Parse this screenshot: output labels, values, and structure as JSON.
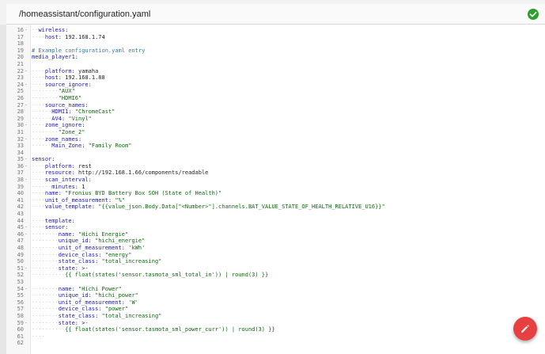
{
  "header": {
    "file_path": "/homeassistant/configuration.yaml",
    "status_icon": "check-circle-icon",
    "status_color": "#2aa22a"
  },
  "fab": {
    "icon": "pencil-icon",
    "color": "#e84040"
  },
  "editor": {
    "lines": [
      {
        "n": "16",
        "fold": "-",
        "ind": "··",
        "key": "wireless:",
        "val": "",
        "type": "key"
      },
      {
        "n": "17",
        "fold": "",
        "ind": "····",
        "key": "host:",
        "val": " 192.168.1.74",
        "type": "key"
      },
      {
        "n": "18",
        "fold": "",
        "ind": "",
        "key": "",
        "val": "",
        "type": "empty"
      },
      {
        "n": "19",
        "fold": "",
        "ind": "",
        "key": "",
        "val": "# Example configuration.yaml entry",
        "type": "comment"
      },
      {
        "n": "20",
        "fold": "",
        "ind": "",
        "key": "media_player1:",
        "val": "",
        "type": "key"
      },
      {
        "n": "21",
        "fold": "",
        "ind": "",
        "key": "",
        "val": "",
        "type": "empty"
      },
      {
        "n": "22",
        "fold": "-",
        "ind": "··-·",
        "key": "platform:",
        "val": " yamaha",
        "type": "key"
      },
      {
        "n": "23",
        "fold": "",
        "ind": "····",
        "key": "host:",
        "val": " 192.168.1.88",
        "type": "key"
      },
      {
        "n": "24",
        "fold": "-",
        "ind": "····",
        "key": "source_ignore:",
        "val": "",
        "type": "key"
      },
      {
        "n": "25",
        "fold": "",
        "ind": "······-·",
        "key": "",
        "val": "\"AUX\"",
        "type": "str"
      },
      {
        "n": "26",
        "fold": "",
        "ind": "······-·",
        "key": "",
        "val": "\"HDMI6\"",
        "type": "str"
      },
      {
        "n": "27",
        "fold": "-",
        "ind": "····",
        "key": "source_names:",
        "val": "",
        "type": "key"
      },
      {
        "n": "28",
        "fold": "",
        "ind": "······",
        "key": "HDMI1:",
        "val": " \"ChromeCast\"",
        "type": "keystr"
      },
      {
        "n": "29",
        "fold": "",
        "ind": "······",
        "key": "AV4:",
        "val": " \"Vinyl\"",
        "type": "keystr"
      },
      {
        "n": "30",
        "fold": "-",
        "ind": "····",
        "key": "zone_ignore:",
        "val": "",
        "type": "key"
      },
      {
        "n": "31",
        "fold": "",
        "ind": "······-·",
        "key": "",
        "val": "\"Zone_2\"",
        "type": "str"
      },
      {
        "n": "32",
        "fold": "-",
        "ind": "····",
        "key": "zone_names:",
        "val": "",
        "type": "key"
      },
      {
        "n": "33",
        "fold": "",
        "ind": "······",
        "key": "Main_Zone:",
        "val": " \"Family Room\"",
        "type": "keystr"
      },
      {
        "n": "34",
        "fold": "",
        "ind": "",
        "key": "",
        "val": "",
        "type": "empty"
      },
      {
        "n": "35",
        "fold": "-",
        "ind": "",
        "key": "sensor:",
        "val": "",
        "type": "key"
      },
      {
        "n": "36",
        "fold": "-",
        "ind": "··-·",
        "key": "platform:",
        "val": " rest",
        "type": "key"
      },
      {
        "n": "37",
        "fold": "",
        "ind": "····",
        "key": "resource:",
        "val": " http://192.168.1.66/components/readable",
        "type": "key"
      },
      {
        "n": "38",
        "fold": "-",
        "ind": "····",
        "key": "scan_interval:",
        "val": "",
        "type": "key"
      },
      {
        "n": "39",
        "fold": "",
        "ind": "······",
        "key": "minutes:",
        "val": " 1",
        "type": "key"
      },
      {
        "n": "40",
        "fold": "",
        "ind": "····",
        "key": "name:",
        "val": " \"Fronius BYD Battery Box SOH (State of Health)\"",
        "type": "keystr"
      },
      {
        "n": "41",
        "fold": "",
        "ind": "····",
        "key": "unit_of_measurement:",
        "val": " \"%\"",
        "type": "keystr"
      },
      {
        "n": "42",
        "fold": "",
        "ind": "····",
        "key": "value_template:",
        "val": " \"{{value_json.Body.Data[\"<Number>\"].channels.BAT_VALUE_STATE_OF_HEALTH_RELATIVE_U16}}\"",
        "type": "keystr"
      },
      {
        "n": "43",
        "fold": "",
        "ind": "",
        "key": "",
        "val": "",
        "type": "empty"
      },
      {
        "n": "44",
        "fold": "",
        "ind": "····",
        "key": "template:",
        "val": "",
        "type": "key"
      },
      {
        "n": "45",
        "fold": "-",
        "ind": "····",
        "key": "sensor:",
        "val": "",
        "type": "key"
      },
      {
        "n": "46",
        "fold": "-",
        "ind": "······-·",
        "key": "name:",
        "val": " \"Hichi Energie\"",
        "type": "keystr"
      },
      {
        "n": "47",
        "fold": "",
        "ind": "········",
        "key": "unique_id:",
        "val": " \"hichi_energie\"",
        "type": "keystr"
      },
      {
        "n": "48",
        "fold": "",
        "ind": "········",
        "key": "unit_of_measurement:",
        "val": " 'kWh'",
        "type": "keystr"
      },
      {
        "n": "49",
        "fold": "",
        "ind": "········",
        "key": "device_class:",
        "val": " \"energy\"",
        "type": "keystr"
      },
      {
        "n": "50",
        "fold": "",
        "ind": "········",
        "key": "state_class:",
        "val": " \"total_increasing\"",
        "type": "keystr"
      },
      {
        "n": "51",
        "fold": "-",
        "ind": "········",
        "key": "state:",
        "val": " >-",
        "type": "key"
      },
      {
        "n": "52",
        "fold": "",
        "ind": "··········",
        "key": "",
        "val": "{{ float(states('sensor.tasmota_sml_total_in')) | round(3) }}",
        "type": "str"
      },
      {
        "n": "53",
        "fold": "",
        "ind": "",
        "key": "",
        "val": "",
        "type": "empty"
      },
      {
        "n": "54",
        "fold": "-",
        "ind": "······-·",
        "key": "name:",
        "val": " \"Hichi Power\"",
        "type": "keystr"
      },
      {
        "n": "55",
        "fold": "",
        "ind": "········",
        "key": "unique_id:",
        "val": " \"hichi_power\"",
        "type": "keystr"
      },
      {
        "n": "56",
        "fold": "",
        "ind": "········",
        "key": "unit_of_measurement:",
        "val": " 'W'",
        "type": "keystr"
      },
      {
        "n": "57",
        "fold": "",
        "ind": "········",
        "key": "device_class:",
        "val": " \"power\"",
        "type": "keystr"
      },
      {
        "n": "58",
        "fold": "",
        "ind": "········",
        "key": "state_class:",
        "val": " \"total_increasing\"",
        "type": "keystr"
      },
      {
        "n": "59",
        "fold": "-",
        "ind": "········",
        "key": "state:",
        "val": " >-",
        "type": "key"
      },
      {
        "n": "60",
        "fold": "",
        "ind": "··········",
        "key": "",
        "val": "{{ float(states('sensor.tasmota_sml_power_curr')) | round(3) }}",
        "type": "str"
      },
      {
        "n": "61",
        "fold": "",
        "ind": "····",
        "key": "",
        "val": "",
        "type": "empty"
      },
      {
        "n": "62",
        "fold": "",
        "ind": "",
        "key": "",
        "val": "",
        "type": "empty"
      }
    ]
  }
}
